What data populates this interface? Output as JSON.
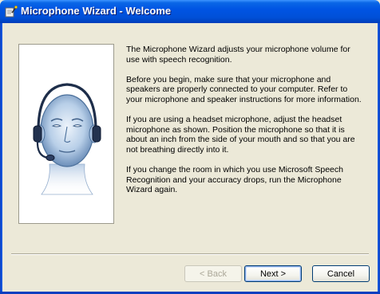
{
  "window": {
    "title": "Microphone Wizard - Welcome",
    "title_icon": "wizard-wand-icon"
  },
  "content": {
    "paragraphs": [
      "The Microphone Wizard adjusts your microphone volume for use with speech recognition.",
      "Before you begin, make sure that your microphone and speakers are properly connected to your computer. Refer to your microphone and speaker instructions for more information.",
      "If you are using a headset microphone, adjust the headset microphone as shown. Position the microphone so that it is about an inch from the side of your mouth and so that you are not breathing directly into it.",
      "If you change the room in which you use Microsoft Speech Recognition and your accuracy drops, run the Microphone Wizard again."
    ]
  },
  "illustration": {
    "icon": "headset-head-illustration"
  },
  "buttons": {
    "back": {
      "label": "< Back",
      "enabled": false
    },
    "next": {
      "label": "Next >",
      "enabled": true,
      "default": true
    },
    "cancel": {
      "label": "Cancel",
      "enabled": true
    }
  },
  "colors": {
    "titlebar": "#0054e3",
    "face_tint": "#b8cfe8",
    "face_stroke": "#4a6f9a",
    "dialog_bg": "#ece9d8"
  }
}
